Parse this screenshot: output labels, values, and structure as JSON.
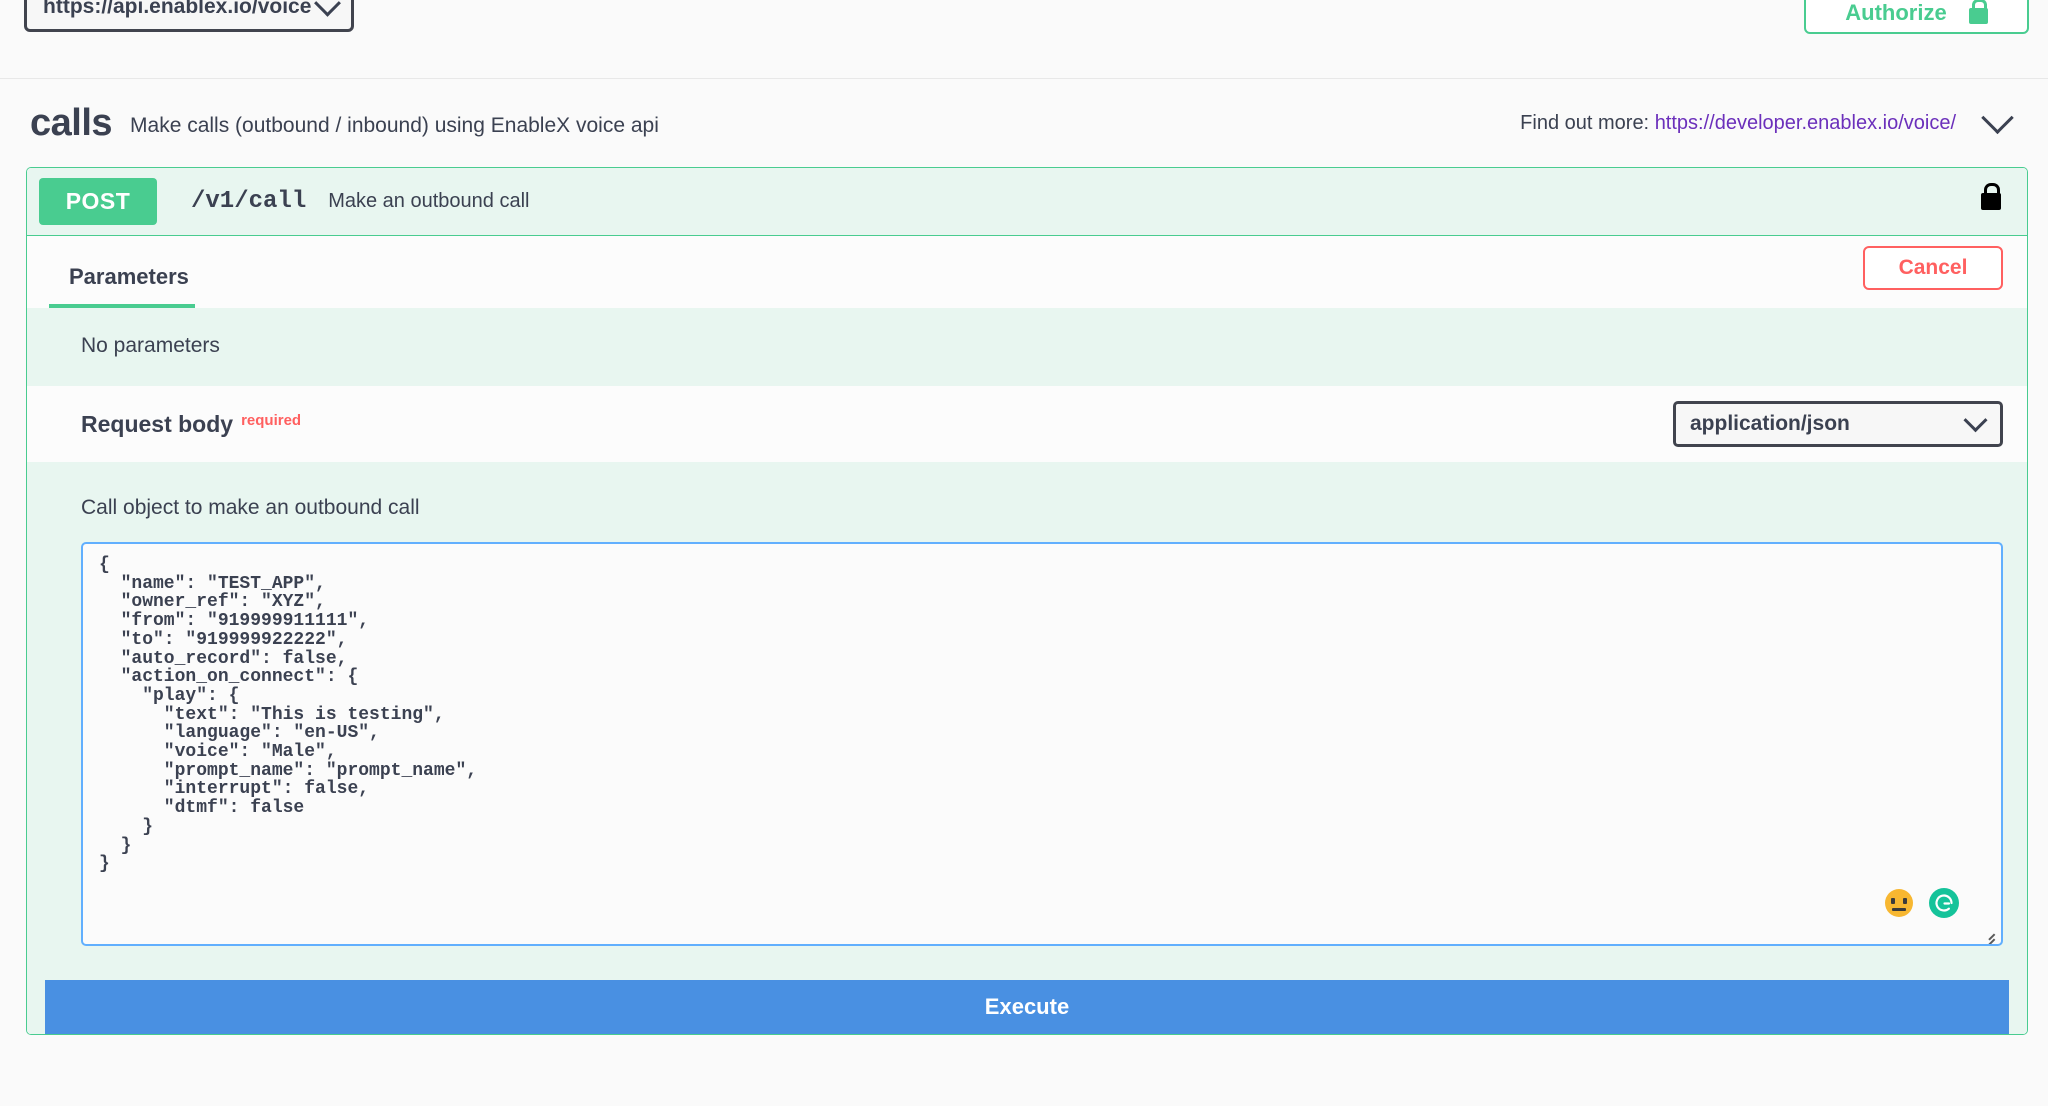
{
  "topbar": {
    "server_url": "https://api.enablex.io/voice",
    "server_chevron_icon": "chevron-down-icon",
    "authorize_label": "Authorize",
    "authorize_lock_icon": "lock-icon"
  },
  "tag": {
    "name": "calls",
    "description": "Make calls (outbound / inbound) using EnableX voice api",
    "find_out_more_label": "Find out more:",
    "find_out_more_url": "https://developer.enablex.io/voice/",
    "expand_icon": "chevron-down-icon"
  },
  "operation": {
    "method": "POST",
    "path": "/v1/call",
    "summary": "Make an outbound call",
    "auth_icon": "lock-icon",
    "tabs": [
      {
        "label": "Parameters",
        "active": true
      }
    ],
    "cancel_label": "Cancel",
    "no_parameters_text": "No parameters",
    "request_body": {
      "label": "Request body",
      "required_label": "required",
      "content_type": "application/json",
      "content_type_chevron_icon": "chevron-down-icon",
      "description": "Call object to make an outbound call",
      "value": "{\n  \"name\": \"TEST_APP\",\n  \"owner_ref\": \"XYZ\",\n  \"from\": \"919999911111\",\n  \"to\": \"919999922222\",\n  \"auto_record\": false,\n  \"action_on_connect\": {\n    \"play\": {\n      \"text\": \"This is testing\",\n      \"language\": \"en-US\",\n      \"voice\": \"Male\",\n      \"prompt_name\": \"prompt_name\",\n      \"interrupt\": false,\n      \"dtmf\": false\n    }\n  }\n}",
      "emoji_icon": "neutral-face-icon",
      "grammarly_icon": "grammarly-icon",
      "resize_icon": "resize-handle-icon"
    },
    "execute_label": "Execute"
  },
  "colors": {
    "method_post": "#49cc90",
    "accent_green": "#49cc90",
    "panel_green_bg": "#e8f6f0",
    "cancel_red": "#ff6060",
    "required_red": "#ff6060",
    "execute_blue": "#4990e2",
    "editor_border_blue": "#61affe",
    "link_purple": "#6b2fbb",
    "text_dark": "#3b4151",
    "grammarly_green": "#15c39a"
  }
}
